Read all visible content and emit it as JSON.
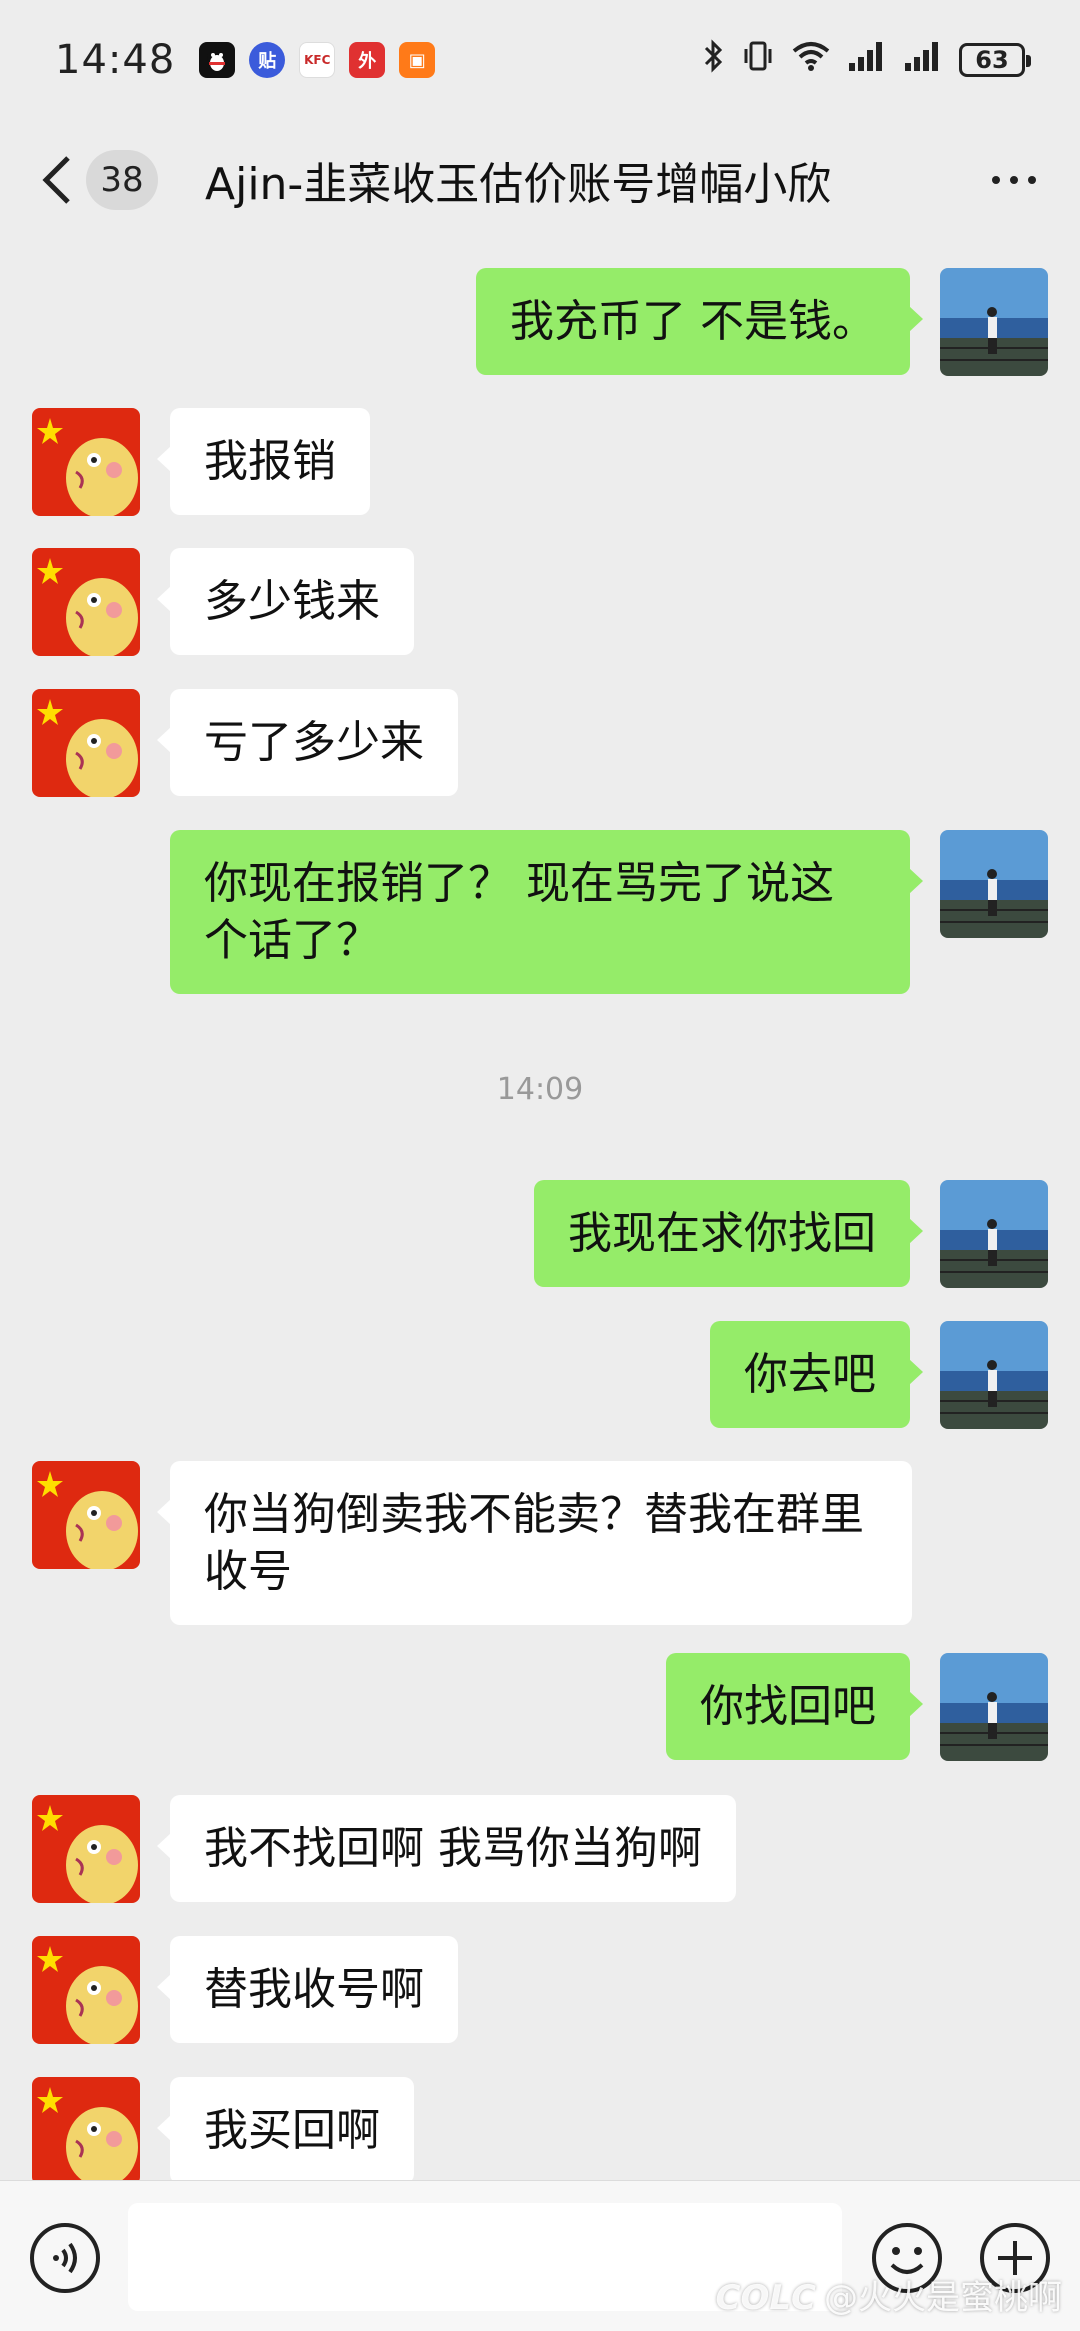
{
  "status_bar": {
    "time": "14:48",
    "battery": "63",
    "notifications": [
      {
        "name": "qq-icon",
        "glyph": "🐧",
        "color": "#ffffff"
      },
      {
        "name": "tieba-icon",
        "glyph": "贴",
        "color": "#3b5bdb"
      },
      {
        "name": "kfc-icon",
        "glyph": "KFC",
        "color": "#ffffff"
      },
      {
        "name": "food-delivery-icon",
        "glyph": "外",
        "color": "#e03131"
      },
      {
        "name": "orange-app-icon",
        "glyph": "▣",
        "color": "#ff7a18"
      }
    ]
  },
  "nav": {
    "unread_count": "38",
    "title": "Ajin-韭菜收玉估价账号增幅小欣"
  },
  "messages": [
    {
      "from": "me",
      "text": "我充币了 不是钱。"
    },
    {
      "from": "other",
      "text": "我报销"
    },
    {
      "from": "other",
      "text": "多少钱来"
    },
    {
      "from": "other",
      "text": "亏了多少来"
    },
    {
      "from": "me",
      "text": "你现在报销了？ 现在骂完了说这个话了？"
    },
    {
      "from": "me",
      "text": "我现在求你找回"
    },
    {
      "from": "me",
      "text": "你去吧"
    },
    {
      "from": "other",
      "text": "你当狗倒卖我不能卖？替我在群里收号"
    },
    {
      "from": "me",
      "text": "你找回吧"
    },
    {
      "from": "other",
      "text": "我不找回啊 我骂你当狗啊"
    },
    {
      "from": "other",
      "text": "替我收号啊"
    },
    {
      "from": "other",
      "text": "我买回啊"
    }
  ],
  "time_divider": "14:09",
  "input_bar": {
    "placeholder": ""
  },
  "watermark": "@火火是蜜桃啊",
  "watermark_logo": "COLC",
  "colors": {
    "background": "#ededed",
    "my_bubble": "#95ec69",
    "other_bubble": "#ffffff"
  }
}
